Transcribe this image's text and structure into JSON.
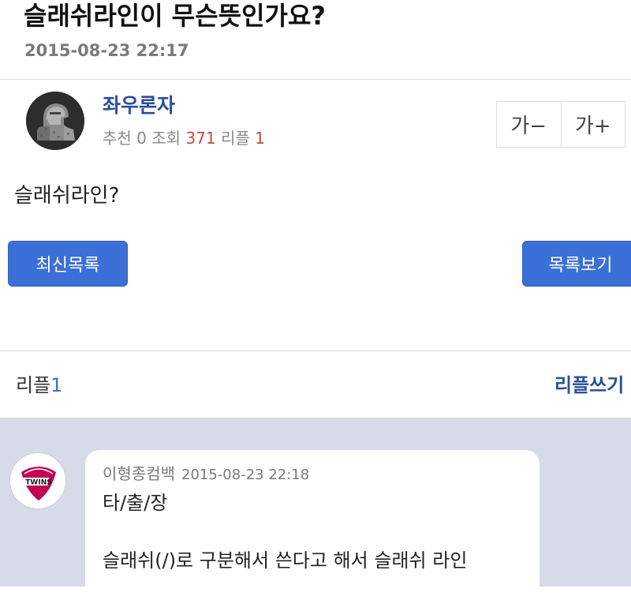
{
  "post": {
    "title": "슬래쉬라인이 무슨뜻인가요?",
    "date": "2015-08-23 22:17",
    "author": "좌우론자",
    "stats": {
      "recommend_label": "추천",
      "recommend_value": "0",
      "views_label": "조회",
      "views_value": "371",
      "replies_label": "리플",
      "replies_value": "1"
    },
    "body": "슬래쉬라인?"
  },
  "font_size": {
    "decrease": "가−",
    "increase": "가+"
  },
  "buttons": {
    "latest_list": "최신목록",
    "view_list": "목록보기"
  },
  "replies": {
    "label": "리플",
    "count": "1",
    "write": "리플쓰기"
  },
  "comment": {
    "author": "이형종컴백",
    "date": "2015-08-23 22:18",
    "line1": "타/출/장",
    "line2": "슬래쉬(/)로 구분해서 쓴다고 해서 슬래쉬 라인",
    "avatar_text": "TWINS"
  },
  "colors": {
    "accent_blue": "#3c70d6",
    "author_blue": "#2a4f99",
    "views_red": "#d0453b",
    "comment_bg": "#d7dbe9"
  }
}
